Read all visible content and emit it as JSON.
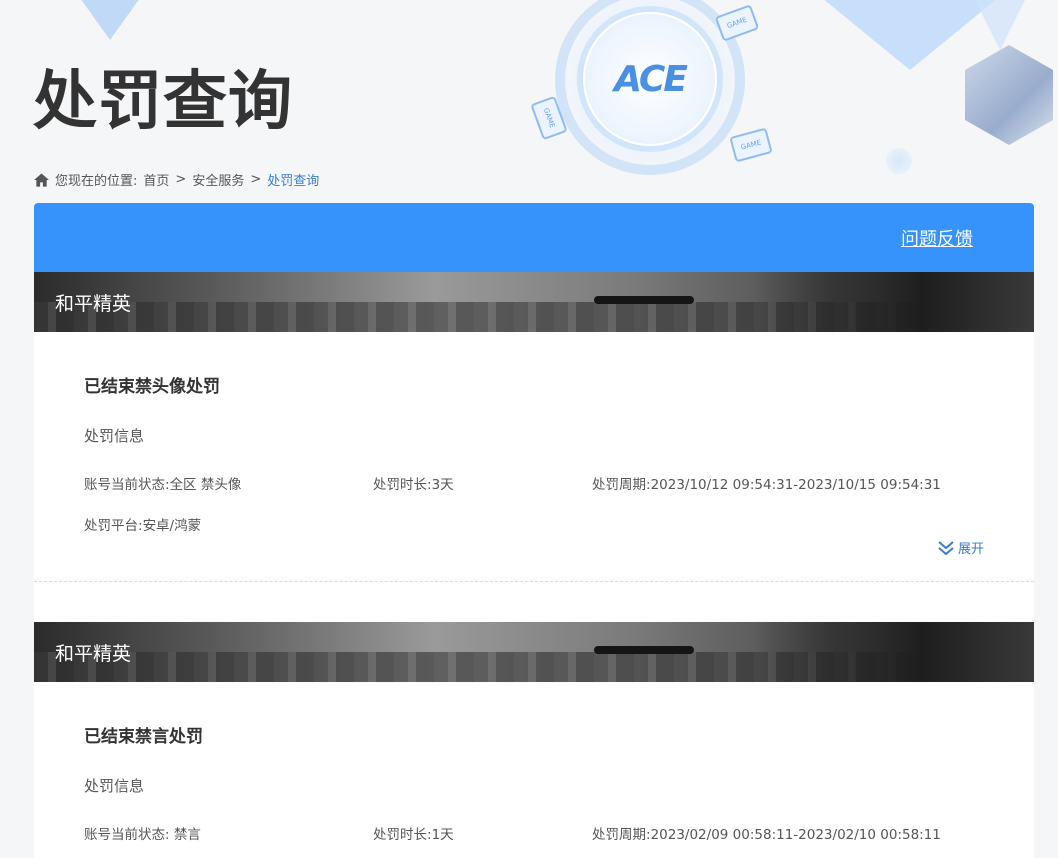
{
  "page": {
    "title": "处罚查询",
    "logo_text": "ACE",
    "game_card_label": "GAME"
  },
  "breadcrumb": {
    "prefix": "您现在的位置:",
    "items": [
      "首页",
      "安全服务",
      "处罚查询"
    ],
    "separator": ">"
  },
  "panel": {
    "feedback_label": "问题反馈"
  },
  "records": [
    {
      "game": "和平精英",
      "title": "已结束禁头像处罚",
      "section_label": "处罚信息",
      "status_label": "账号当前状态:",
      "status_value": "全区 禁头像",
      "duration_label": "处罚时长:",
      "duration_value": "3天",
      "period_label": "处罚周期:",
      "period_value": "2023/10/12 09:54:31-2023/10/15 09:54:31",
      "platform_label": "处罚平台:",
      "platform_value": "安卓/鸿蒙",
      "expand_label": "展开"
    },
    {
      "game": "和平精英",
      "title": "已结束禁言处罚",
      "section_label": "处罚信息",
      "status_label": "账号当前状态:",
      "status_value": "禁言",
      "duration_label": "处罚时长:",
      "duration_value": "1天",
      "period_label": "处罚周期:",
      "period_value": "2023/02/09 00:58:11-2023/02/10 00:58:11"
    }
  ],
  "colors": {
    "accent": "#3693fb",
    "link": "#3a7bd5",
    "text": "#333333"
  }
}
